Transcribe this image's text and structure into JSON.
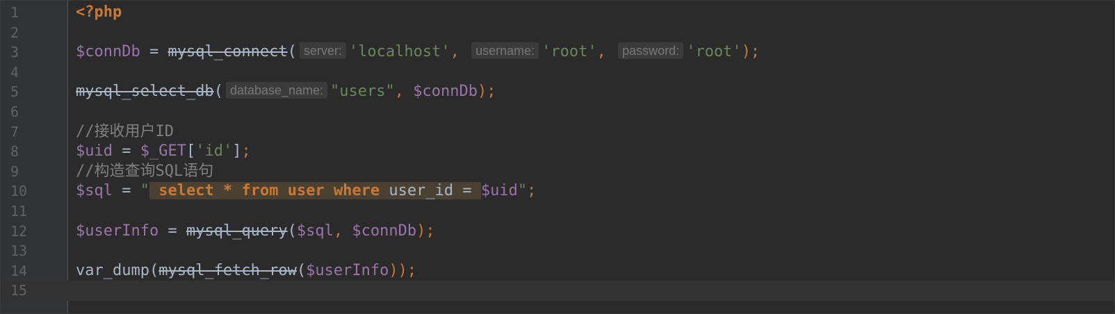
{
  "editor": {
    "lines": [
      {
        "num": "1"
      },
      {
        "num": "2"
      },
      {
        "num": "3"
      },
      {
        "num": "4"
      },
      {
        "num": "5"
      },
      {
        "num": "6"
      },
      {
        "num": "7"
      },
      {
        "num": "8"
      },
      {
        "num": "9"
      },
      {
        "num": "10"
      },
      {
        "num": "11"
      },
      {
        "num": "12"
      },
      {
        "num": "13"
      },
      {
        "num": "14"
      },
      {
        "num": "15"
      }
    ],
    "code": {
      "l1": {
        "open": "<?php"
      },
      "l3": {
        "var": "$connDb",
        "eq": " = ",
        "fn": "mysql_connect",
        "lp": "(",
        "hint1": "server:",
        "arg1": "'localhost'",
        "c1": ", ",
        "hint2": "username:",
        "arg2": "'root'",
        "c2": ", ",
        "hint3": "password:",
        "arg3": "'root'",
        "end": ");"
      },
      "l5": {
        "fn": "mysql_select_db",
        "lp": "(",
        "hint1": "database_name:",
        "arg1": "\"users\"",
        "c1": ", ",
        "var": "$connDb",
        "end": ");"
      },
      "l7": {
        "comment": "//接收用户ID"
      },
      "l8": {
        "var": "$uid",
        "eq": " = ",
        "get": "$_GET",
        "lb": "[",
        "key": "'id'",
        "rb": "]",
        "semi": ";"
      },
      "l9": {
        "comment": "//构造查询SQL语句"
      },
      "l10": {
        "var": "$sql",
        "eq": " = ",
        "q1": "\"",
        "sp": " ",
        "k1": "select",
        "star": " * ",
        "k2": "from",
        "t1": " user ",
        "k3": "where",
        "t2": " user_id = ",
        "svar": "$uid",
        "q2": "\"",
        "semi": ";"
      },
      "l12": {
        "var": "$userInfo",
        "eq": " = ",
        "fn": "mysql_query",
        "lp": "(",
        "a1": "$sql",
        "c1": ", ",
        "a2": "$connDb",
        "end": ");"
      },
      "l14": {
        "fn": "var_dump",
        "lp": "(",
        "fn2": "mysql_fetch_row",
        "lp2": "(",
        "a1": "$userInfo",
        "end": "));"
      }
    }
  },
  "colors": {
    "background": "#2b2b2b",
    "gutter": "#313335",
    "keyword": "#cc7832",
    "variable": "#9876aa",
    "string": "#6a8759",
    "comment": "#808080",
    "default": "#a9b7c6"
  }
}
